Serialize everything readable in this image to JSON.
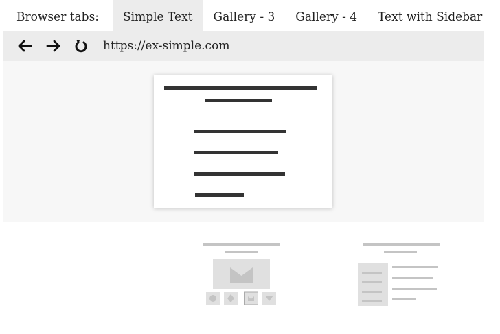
{
  "tabbar": {
    "label": "Browser tabs:",
    "tabs": [
      {
        "label": "Simple Text",
        "active": true
      },
      {
        "label": "Gallery - 3",
        "active": false
      },
      {
        "label": "Gallery - 4",
        "active": false
      },
      {
        "label": "Text with Sidebar",
        "active": false
      }
    ]
  },
  "toolbar": {
    "back_icon": "arrow-left-icon",
    "forward_icon": "arrow-right-icon",
    "reload_icon": "reload-icon",
    "url": "https://ex-simple.com"
  },
  "thumbnails": [
    {
      "name": "gallery-preview",
      "icon": "mail-icon"
    },
    {
      "name": "sidebar-preview"
    }
  ],
  "colors": {
    "active_tab": "#ececec",
    "toolbar": "#ececec",
    "viewport": "#f7f7f7",
    "text_bar": "#333333",
    "placeholder": "#c4c4c4"
  }
}
